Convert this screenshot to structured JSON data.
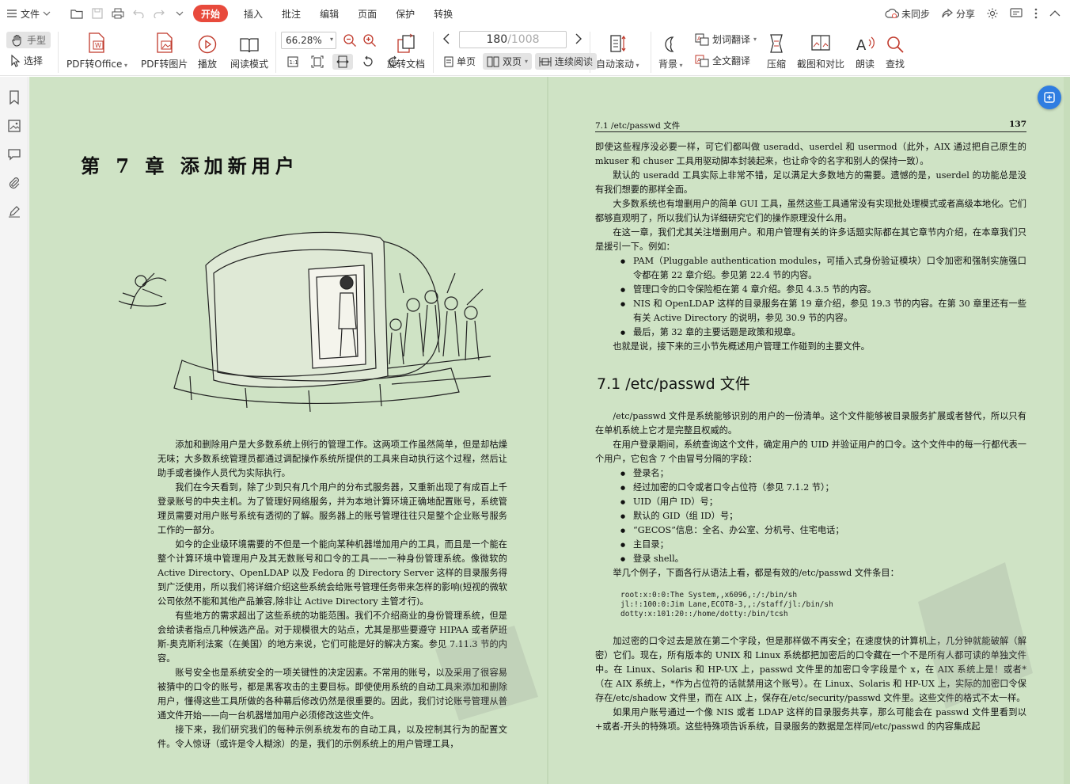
{
  "menubar": {
    "file_label": "文件",
    "tabs": [
      "开始",
      "插入",
      "批注",
      "编辑",
      "页面",
      "保护",
      "转换"
    ],
    "active_tab": "开始",
    "sync_label": "未同步",
    "share_label": "分享"
  },
  "ribbon": {
    "hand_tool": "手型",
    "select_tool": "选择",
    "pdf_to_office": "PDF转Office",
    "pdf_to_image": "PDF转图片",
    "play": "播放",
    "read_mode": "阅读模式",
    "zoom_value": "66.28%",
    "rotate_doc": "旋转文档",
    "page_current": "180",
    "page_total": "/1008",
    "single_page": "单页",
    "double_page": "双页",
    "continuous_read": "连续阅读",
    "auto_scroll": "自动滚动",
    "background": "背景",
    "word_translate": "划词翻译",
    "full_translate": "全文翻译",
    "compress": "压缩",
    "screenshot_compare": "截图和对比",
    "read_aloud": "朗读",
    "find": "查找"
  },
  "left_page": {
    "chapter_title": "第 7 章   添加新用户",
    "paragraphs": [
      "添加和删除用户是大多数系统上例行的管理工作。这两项工作虽然简单，但是却枯燥无味；大多数系统管理员都通过调配操作系统所提供的工具来自动执行这个过程，然后让助手或者操作人员代为实际执行。",
      "我们在今天看到，除了少到只有几个用户的分布式服务器，又重新出现了有成百上千登录账号的中央主机。为了管理好网络服务，并为本地计算环境正确地配置账号，系统管理员需要对用户账号系统有透彻的了解。服务器上的账号管理往往只是整个企业账号服务工作的一部分。",
      "如今的企业级环境需要的不但是一个能向某种机器增加用户的工具，而且是一个能在整个计算环境中管理用户及其无数账号和口令的工具——一种身份管理系统。像微软的 Active Directory、OpenLDAP 以及 Fedora 的 Directory Server 这样的目录服务得到广泛使用，所以我们将详细介绍这些系统会给账号管理任务带来怎样的影响(短视的微软公司依然不能和其他产品兼容,除非让 Active Directory 主管才行)。",
      "有些地方的需求超出了这些系统的功能范围。我们不介绍商业的身份管理系统，但是会给读者指点几种候选产品。对于规模很大的站点，尤其是那些要遵守 HIPAA 或者萨班斯-奥克斯利法案（在美国）的地方来说，它们可能是好的解决方案。参见 7.11.3 节的内容。",
      "账号安全也是系统安全的一项关键性的决定因素。不常用的账号，以及采用了很容易被猜中的口令的账号，都是黑客攻击的主要目标。即使使用系统的自动工具来添加和删除用户，懂得这些工具所做的各种幕后修改仍然是很重要的。因此，我们讨论账号管理从普通文件开始——向一台机器增加用户必须修改这些文件。",
      "接下来，我们研究我们的每种示例系统发布的自动工具，以及控制其行为的配置文件。令人惊讶（或许是令人糊涂）的是，我们的示例系统上的用户管理工具，"
    ]
  },
  "right_page": {
    "running_head": "7.1   /etc/passwd 文件",
    "page_number": "137",
    "intro_paragraphs": [
      "即使这些程序没必要一样，可它们都叫做 useradd、userdel 和 usermod（此外，AIX 通过把自己原生的 mkuser 和 chuser 工具用驱动脚本封装起来，也让命令的名字和别人的保持一致）。",
      "默认的 useradd 工具实际上非常不错，足以满足大多数地方的需要。遗憾的是，userdel 的功能总是没有我们想要的那样全面。",
      "大多数系统也有增删用户的简单 GUI 工具，虽然这些工具通常没有实现批处理模式或者高级本地化。它们都够直观明了，所以我们认为详细研究它们的操作原理没什么用。",
      "在这一章，我们尤其关注增删用户。和用户管理有关的许多话题实际都在其它章节内介绍，在本章我们只是援引一下。例如："
    ],
    "intro_bullets": [
      "PAM（Pluggable authentication modules，可插入式身份验证模块）口令加密和强制实施强口令都在第 22 章介绍。参见第 22.4 节的内容。",
      "管理口令的口令保险柜在第 4 章介绍。参见 4.3.5 节的内容。",
      "NIS 和 OpenLDAP 这样的目录服务在第 19 章介绍，参见 19.3 节的内容。在第 30 章里还有一些有关 Active Directory 的说明，参见 30.9 节的内容。",
      "最后，第 32 章的主要话题是政策和规章。"
    ],
    "after_bullets": "也就是说，接下来的三小节先概述用户管理工作碰到的主要文件。",
    "section_title": "7.1   /etc/passwd 文件",
    "section_paragraphs": [
      "/etc/passwd 文件是系统能够识别的用户的一份清单。这个文件能够被目录服务扩展或者替代，所以只有在单机系统上它才是完整且权威的。",
      "在用户登录期间，系统查询这个文件，确定用户的 UID 并验证用户的口令。这个文件中的每一行都代表一个用户，它包含 7 个由冒号分隔的字段："
    ],
    "field_bullets": [
      "登录名；",
      "经过加密的口令或者口令占位符（参见 7.1.2 节）；",
      "UID（用户 ID）号；",
      "默认的 GID（组 ID）号；",
      "“GECOS”信息：全名、办公室、分机号、住宅电话；",
      "主目录；",
      "登录 shell。"
    ],
    "example_intro": "举几个例子，下面各行从语法上看，都是有效的/etc/passwd 文件条目：",
    "code_lines": [
      "root:x:0:0:The System,,x6096,:/:/bin/sh",
      "jl:!:100:0:Jim Lane,ECOT8-3,,:/staff/jl:/bin/sh",
      "dotty:x:101:20::/home/dotty:/bin/tcsh"
    ],
    "closing_paragraphs": [
      "加过密的口令过去是放在第二个字段，但是那样做不再安全；在速度快的计算机上，几分钟就能破解（解密）它们。现在，所有版本的 UNIX 和 Linux 系统都把加密后的口令藏在一个不是所有人都可读的单独文件中。在 Linux、Solaris 和 HP-UX 上，passwd 文件里的加密口令字段是个 x，在 AIX 系统上是！或者*（在 AIX 系统上，*作为占位符的话就禁用这个账号）。在 Linux、Solaris 和 HP-UX 上，实际的加密口令保存在/etc/shadow 文件里，而在 AIX 上，保存在/etc/security/passwd 文件里。这些文件的格式不太一样。",
      "如果用户账号通过一个像 NIS 或者 LDAP 这样的目录服务共享，那么可能会在 passwd 文件里看到以+或者-开头的特殊项。这些特殊项告诉系统，目录服务的数据是怎样同/etc/passwd 的内容集成起"
    ]
  },
  "colors": {
    "accent": "#e84a3c",
    "page_background": "#cfe3c5",
    "fab": "#2f7de1"
  }
}
